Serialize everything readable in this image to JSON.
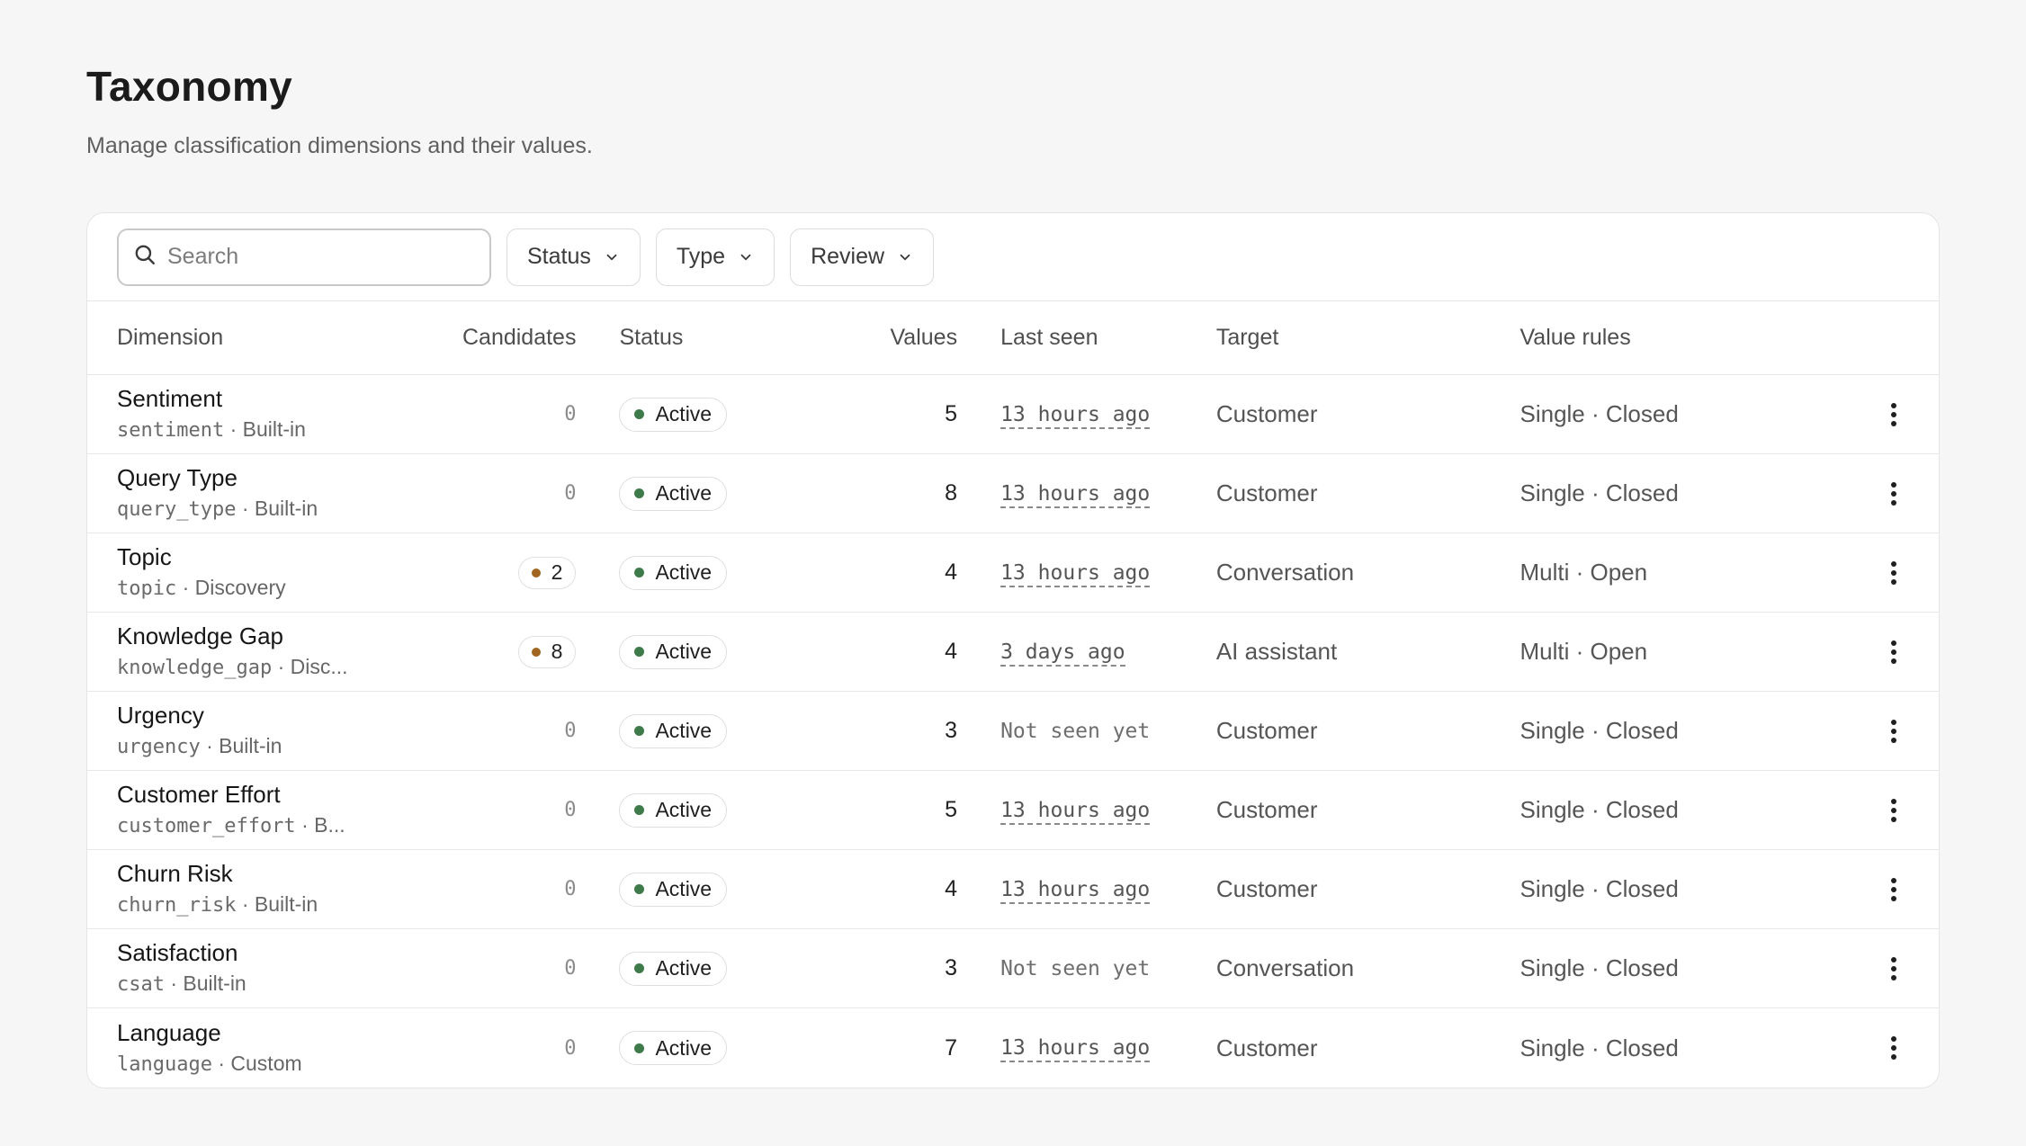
{
  "page": {
    "title": "Taxonomy",
    "subtitle": "Manage classification dimensions and their values."
  },
  "toolbar": {
    "search_placeholder": "Search",
    "filters": [
      {
        "label": "Status"
      },
      {
        "label": "Type"
      },
      {
        "label": "Review"
      }
    ]
  },
  "table": {
    "headers": {
      "dimension": "Dimension",
      "candidates": "Candidates",
      "status": "Status",
      "values": "Values",
      "last_seen": "Last seen",
      "target": "Target",
      "value_rules": "Value rules"
    },
    "rows": [
      {
        "name": "Sentiment",
        "key": "sentiment",
        "source": " · Built-in",
        "candidates": "0",
        "status": "Active",
        "values": "5",
        "last_seen": "13 hours ago",
        "target": "Customer",
        "rules": "Single · Closed"
      },
      {
        "name": "Query Type",
        "key": "query_type",
        "source": " · Built-in",
        "candidates": "0",
        "status": "Active",
        "values": "8",
        "last_seen": "13 hours ago",
        "target": "Customer",
        "rules": "Single · Closed"
      },
      {
        "name": "Topic",
        "key": "topic",
        "source": " · Discovery",
        "candidates": "2",
        "status": "Active",
        "values": "4",
        "last_seen": "13 hours ago",
        "target": "Conversation",
        "rules": "Multi · Open"
      },
      {
        "name": "Knowledge Gap",
        "key": "knowledge_gap",
        "source": " · Disc...",
        "candidates": "8",
        "status": "Active",
        "values": "4",
        "last_seen": "3 days ago",
        "target": "AI assistant",
        "rules": "Multi · Open"
      },
      {
        "name": "Urgency",
        "key": "urgency",
        "source": " · Built-in",
        "candidates": "0",
        "status": "Active",
        "values": "3",
        "last_seen": "Not seen yet",
        "target": "Customer",
        "rules": "Single · Closed"
      },
      {
        "name": "Customer Effort",
        "key": "customer_effort",
        "source": " · B...",
        "candidates": "0",
        "status": "Active",
        "values": "5",
        "last_seen": "13 hours ago",
        "target": "Customer",
        "rules": "Single · Closed"
      },
      {
        "name": "Churn Risk",
        "key": "churn_risk",
        "source": " · Built-in",
        "candidates": "0",
        "status": "Active",
        "values": "4",
        "last_seen": "13 hours ago",
        "target": "Customer",
        "rules": "Single · Closed"
      },
      {
        "name": "Satisfaction",
        "key": "csat",
        "source": " · Built-in",
        "candidates": "0",
        "status": "Active",
        "values": "3",
        "last_seen": "Not seen yet",
        "target": "Conversation",
        "rules": "Single · Closed"
      },
      {
        "name": "Language",
        "key": "language",
        "source": " · Custom",
        "candidates": "0",
        "status": "Active",
        "values": "7",
        "last_seen": "13 hours ago",
        "target": "Customer",
        "rules": "Single · Closed"
      }
    ]
  },
  "icons": {
    "search": "search-icon",
    "chevron": "chevron-down-icon",
    "menu": "more-vertical-icon"
  },
  "colors": {
    "active_dot": "#3f7a4a",
    "candidate_dot": "#a0661f"
  }
}
